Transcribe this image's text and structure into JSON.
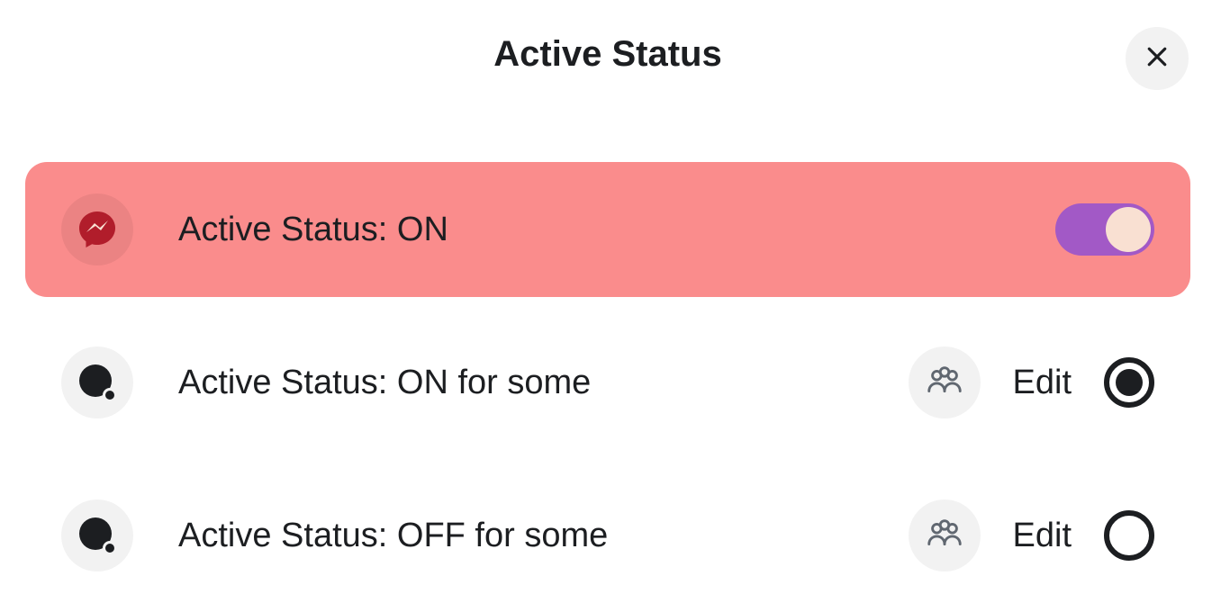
{
  "dialog": {
    "title": "Active Status"
  },
  "options": [
    {
      "label": "Active Status: ON",
      "control": "toggle",
      "toggle_on": true,
      "highlighted": true
    },
    {
      "label": "Active Status: ON for some",
      "control": "radio",
      "selected": true,
      "edit_label": "Edit"
    },
    {
      "label": "Active Status: OFF for some",
      "control": "radio",
      "selected": false,
      "edit_label": "Edit"
    }
  ],
  "colors": {
    "highlight_bg": "#fa8c8c",
    "toggle_track": "#a259c6",
    "toggle_knob": "#f9e0d2",
    "messenger_red": "#b11d2b"
  }
}
